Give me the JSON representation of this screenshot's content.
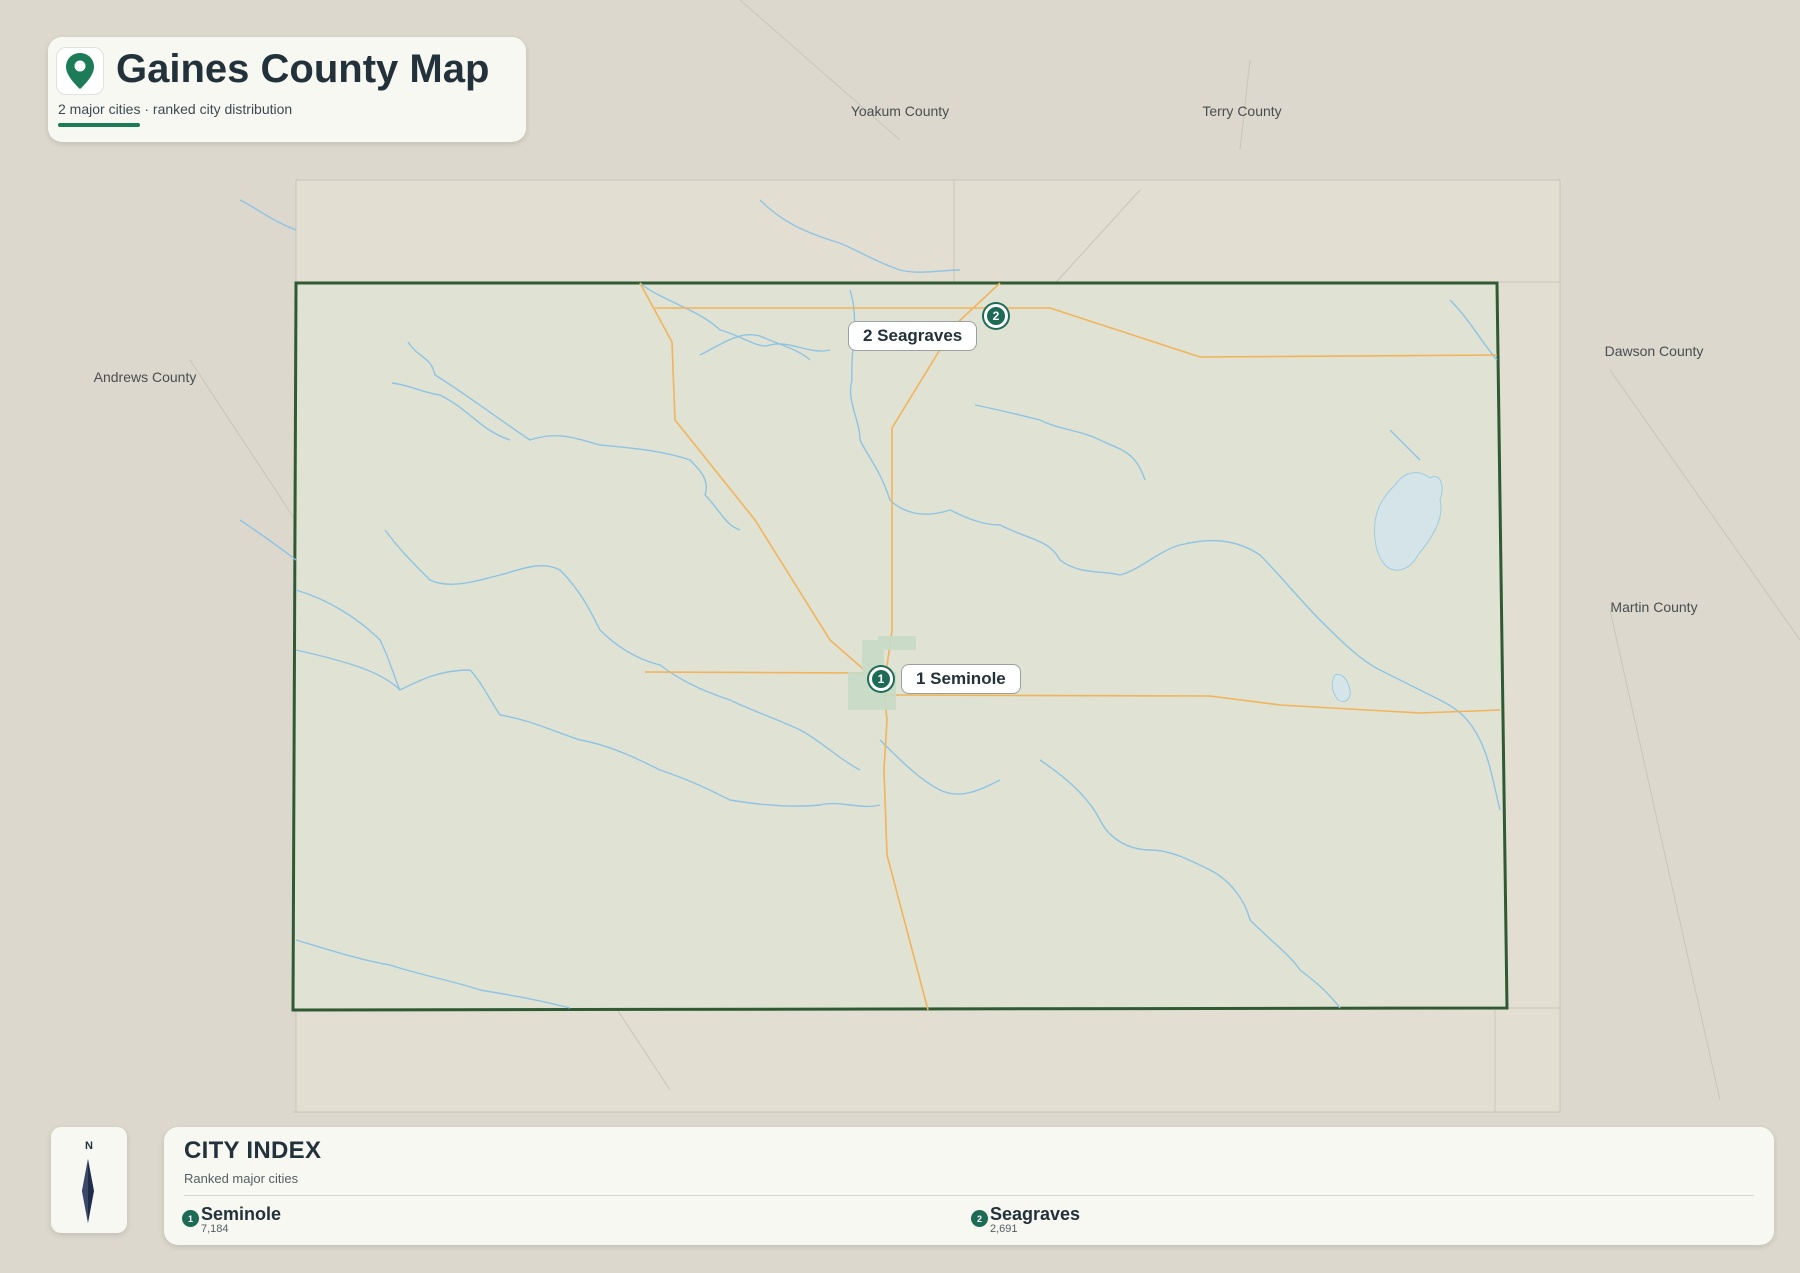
{
  "title": {
    "text": "Gaines County Map",
    "subtitle": "2 major cities · ranked city distribution",
    "icon": "map-pin-icon",
    "accent_color": "#1d7c58"
  },
  "neighbor_counties": [
    {
      "id": "yoakum",
      "name": "Yoakum County"
    },
    {
      "id": "terry",
      "name": "Terry County"
    },
    {
      "id": "andrews",
      "name": "Andrews County"
    },
    {
      "id": "dawson",
      "name": "Dawson County"
    },
    {
      "id": "martin",
      "name": "Martin County"
    }
  ],
  "cities": [
    {
      "rank": "1",
      "name": "Seminole",
      "label": "1 Seminole",
      "population": "7,184"
    },
    {
      "rank": "2",
      "name": "Seagraves",
      "label": "2 Seagraves",
      "population": "2,691"
    }
  ],
  "compass": {
    "north_label": "N",
    "icon": "compass-needle-icon"
  },
  "city_index": {
    "title": "CITY INDEX",
    "subtitle": "Ranked major cities"
  },
  "colors": {
    "county_border": "#2f5a34",
    "county_fill": "#e0e3d3",
    "water": "#8fc3e3",
    "roads": "#f1b35b",
    "marker": "#1d6b55"
  }
}
